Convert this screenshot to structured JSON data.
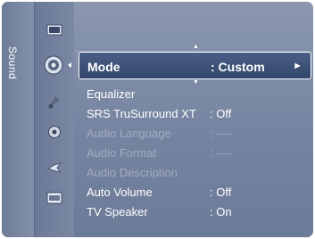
{
  "side_tab": {
    "label": "Sound"
  },
  "icons": [
    {
      "name": "picture-icon"
    },
    {
      "name": "sound-icon",
      "active": true
    },
    {
      "name": "channel-icon"
    },
    {
      "name": "setup-icon"
    },
    {
      "name": "input-icon"
    },
    {
      "name": "application-icon"
    }
  ],
  "selected": {
    "label": "Mode",
    "value": ": Custom",
    "arrow": "►"
  },
  "menu": {
    "items": [
      {
        "label": "Equalizer",
        "value": ""
      },
      {
        "label": "SRS TruSurround XT",
        "value": ": Off"
      },
      {
        "label": "Audio Language",
        "value": ": ----",
        "disabled": true
      },
      {
        "label": "Audio Format",
        "value": ": ----",
        "disabled": true
      },
      {
        "label": "Audio Description",
        "value": "",
        "disabled": true
      },
      {
        "label": "Auto Volume",
        "value": ": Off"
      },
      {
        "label": "TV Speaker",
        "value": ": On"
      }
    ]
  },
  "colors": {
    "panel": "#7584a0",
    "selected_bg": "#3b4f76",
    "text": "#ffffff",
    "disabled_text": "#a3acbf"
  }
}
